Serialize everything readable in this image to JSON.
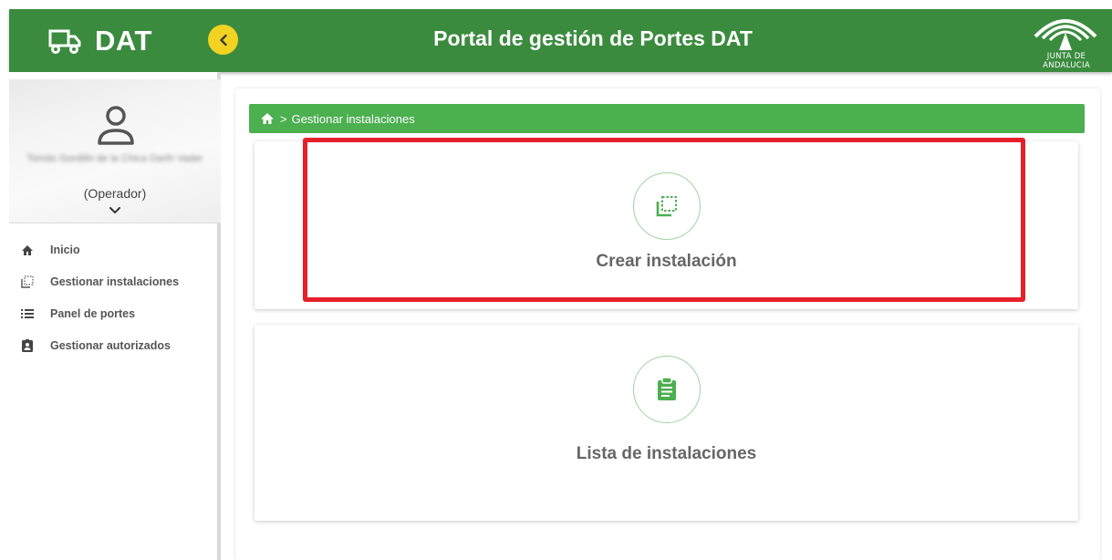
{
  "header": {
    "brand_title": "DAT",
    "portal_title": "Portal de gestión de Portes DAT",
    "logo_text": "JUNTA DE ANDALUCIA",
    "color": "#3b8b3f",
    "accent": "#f3d321"
  },
  "sidebar": {
    "user_name": "Tomás Gordillo de la Chica Darth Vader",
    "user_role": "(Operador)",
    "items": [
      {
        "label": "Inicio",
        "icon": "home-icon"
      },
      {
        "label": "Gestionar instalaciones",
        "icon": "install-icon"
      },
      {
        "label": "Panel de portes",
        "icon": "list-icon"
      },
      {
        "label": "Gestionar autorizados",
        "icon": "badge-icon"
      }
    ]
  },
  "breadcrumb": {
    "current": "Gestionar instalaciones",
    "separator": ">"
  },
  "cards": [
    {
      "label": "Crear instalación",
      "icon": "create-install-icon"
    },
    {
      "label": "Lista de instalaciones",
      "icon": "clipboard-icon"
    }
  ],
  "highlight": {
    "color": "#e5202b"
  }
}
